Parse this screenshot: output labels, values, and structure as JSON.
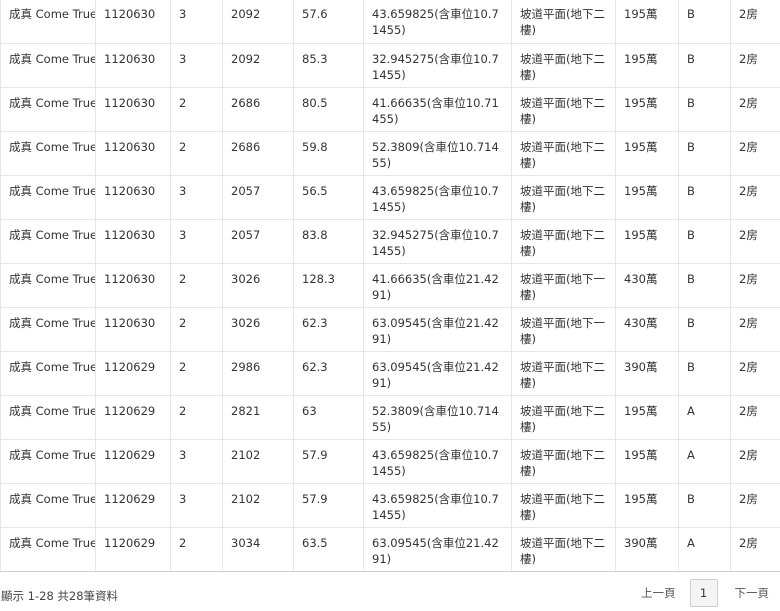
{
  "table": {
    "rows": [
      [
        "成真 Come True",
        "1120630",
        "3",
        "2092",
        "57.6",
        "43.659825(含車位10.71455)",
        "坡道平面(地下二樓)",
        "195萬",
        "B",
        "2房"
      ],
      [
        "成真 Come True",
        "1120630",
        "3",
        "2092",
        "85.3",
        "32.945275(含車位10.71455)",
        "坡道平面(地下二樓)",
        "195萬",
        "B",
        "2房"
      ],
      [
        "成真 Come True",
        "1120630",
        "2",
        "2686",
        "80.5",
        "41.66635(含車位10.71455)",
        "坡道平面(地下二樓)",
        "195萬",
        "B",
        "2房"
      ],
      [
        "成真 Come True",
        "1120630",
        "2",
        "2686",
        "59.8",
        "52.3809(含車位10.71455)",
        "坡道平面(地下二樓)",
        "195萬",
        "B",
        "2房"
      ],
      [
        "成真 Come True",
        "1120630",
        "3",
        "2057",
        "56.5",
        "43.659825(含車位10.71455)",
        "坡道平面(地下二樓)",
        "195萬",
        "B",
        "2房"
      ],
      [
        "成真 Come True",
        "1120630",
        "3",
        "2057",
        "83.8",
        "32.945275(含車位10.71455)",
        "坡道平面(地下二樓)",
        "195萬",
        "B",
        "2房"
      ],
      [
        "成真 Come True",
        "1120630",
        "2",
        "3026",
        "128.3",
        "41.66635(含車位21.4291)",
        "坡道平面(地下一樓)",
        "430萬",
        "B",
        "2房"
      ],
      [
        "成真 Come True",
        "1120630",
        "2",
        "3026",
        "62.3",
        "63.09545(含車位21.4291)",
        "坡道平面(地下一樓)",
        "430萬",
        "B",
        "2房"
      ],
      [
        "成真 Come True",
        "1120629",
        "2",
        "2986",
        "62.3",
        "63.09545(含車位21.4291)",
        "坡道平面(地下二樓)",
        "390萬",
        "B",
        "2房"
      ],
      [
        "成真 Come True",
        "1120629",
        "2",
        "2821",
        "63",
        "52.3809(含車位10.71455)",
        "坡道平面(地下二樓)",
        "195萬",
        "A",
        "2房"
      ],
      [
        "成真 Come True",
        "1120629",
        "3",
        "2102",
        "57.9",
        "43.659825(含車位10.71455)",
        "坡道平面(地下二樓)",
        "195萬",
        "A",
        "2房"
      ],
      [
        "成真 Come True",
        "1120629",
        "3",
        "2102",
        "57.9",
        "43.659825(含車位10.71455)",
        "坡道平面(地下二樓)",
        "195萬",
        "B",
        "2房"
      ],
      [
        "成真 Come True",
        "1120629",
        "2",
        "3034",
        "63.5",
        "63.09545(含車位21.4291)",
        "坡道平面(地下二樓)",
        "390萬",
        "A",
        "2房"
      ]
    ]
  },
  "footer": {
    "summary": "顯示 1-28 共28筆資料",
    "prev_label": "上一頁",
    "current_page": "1",
    "next_label": "下一頁"
  }
}
